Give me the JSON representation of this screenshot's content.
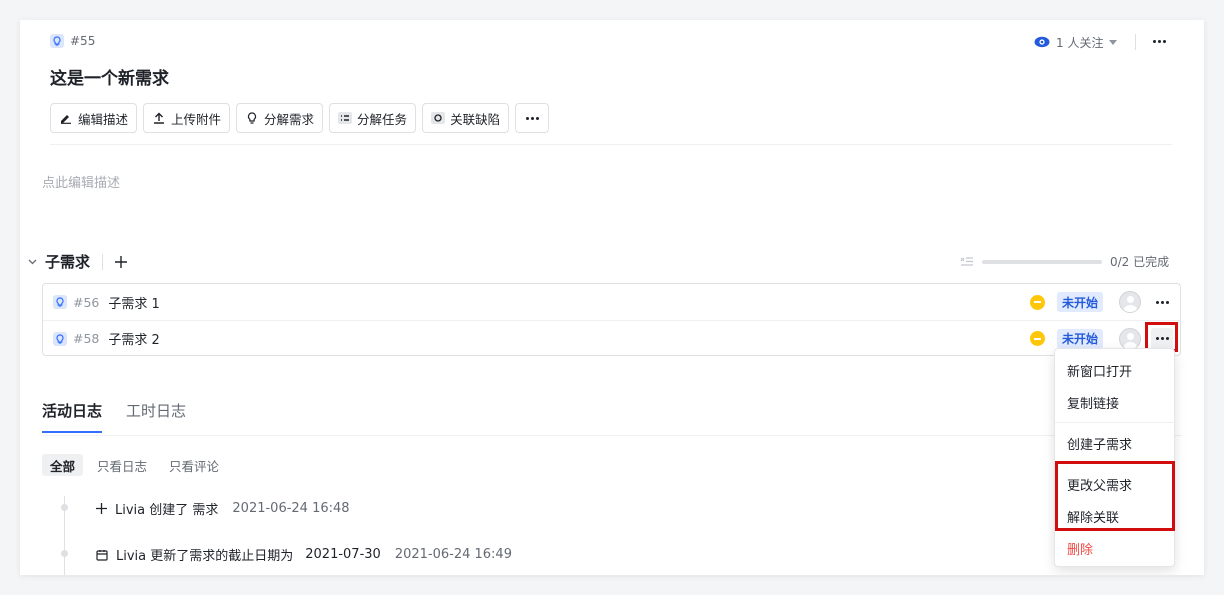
{
  "item": {
    "id": "#55",
    "title": "这是一个新需求"
  },
  "follow": {
    "label": "1 人关注"
  },
  "toolbar": [
    "编辑描述",
    "上传附件",
    "分解需求",
    "分解任务",
    "关联缺陷"
  ],
  "description": {
    "placeholder": "点此编辑描述"
  },
  "subreq": {
    "title": "子需求",
    "progress": {
      "text": "0/2 已完成",
      "fraction": 0
    },
    "rows": [
      {
        "id": "#56",
        "name": "子需求 1",
        "status": "未开始"
      },
      {
        "id": "#58",
        "name": "子需求 2",
        "status": "未开始"
      }
    ]
  },
  "tabs": [
    "活动日志",
    "工时日志"
  ],
  "filters": [
    "全部",
    "只看日志",
    "只看评论"
  ],
  "logs": [
    {
      "text": "Livia 创建了 需求",
      "date": "",
      "time": "2021-06-24 16:48"
    },
    {
      "text": "Livia 更新了需求的截止日期为",
      "date": "2021-07-30",
      "time": "2021-06-24 16:49"
    }
  ],
  "menu": [
    "新窗口打开",
    "复制链接",
    "创建子需求",
    "更改父需求",
    "解除关联",
    "删除"
  ],
  "colors": {
    "accent": "#3370ff",
    "priority": "#ffc60a",
    "danger": "#f54a45",
    "highlight": "#d10d0d"
  }
}
